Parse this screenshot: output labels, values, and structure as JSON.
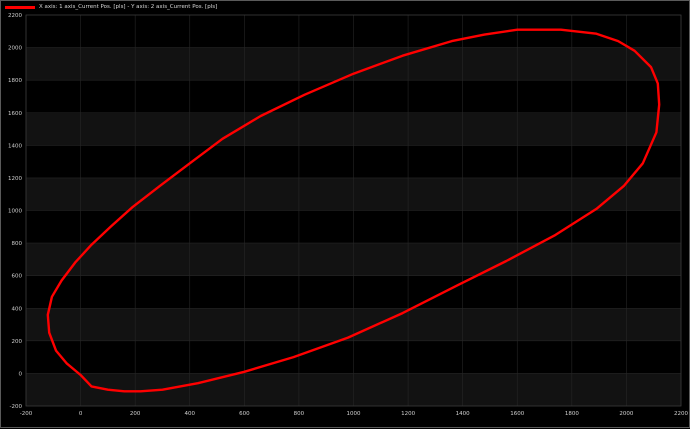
{
  "chart_data": {
    "type": "line",
    "title": "",
    "xlabel": "",
    "ylabel": "",
    "xlim": [
      -200,
      2200
    ],
    "ylim": [
      -200,
      2200
    ],
    "xticks": [
      -200,
      0,
      200,
      400,
      600,
      800,
      1000,
      1200,
      1400,
      1600,
      1800,
      2000,
      2200
    ],
    "yticks": [
      -200,
      0,
      200,
      400,
      600,
      800,
      1000,
      1200,
      1400,
      1600,
      1800,
      2000,
      2200
    ],
    "grid": true,
    "legend_position": "top-left",
    "series": [
      {
        "name": "X axis: 1 axis_Current Pos. [pls] - Y axis: 2 axis_Current Pos. [pls]",
        "color": "#ff0000",
        "x": [
          1600,
          1760,
          1890,
          1970,
          2030,
          2090,
          2115,
          2120,
          2110,
          2060,
          1990,
          1890,
          1740,
          1560,
          1380,
          1180,
          980,
          780,
          600,
          430,
          300,
          220,
          160,
          100,
          40,
          0,
          -50,
          -90,
          -115,
          -120,
          -105,
          -70,
          -20,
          40,
          110,
          190,
          290,
          400,
          520,
          660,
          820,
          1000,
          1180,
          1360,
          1480,
          1600
        ],
        "y": [
          2110,
          2110,
          2085,
          2040,
          1980,
          1880,
          1780,
          1650,
          1480,
          1290,
          1150,
          1010,
          850,
          690,
          540,
          370,
          220,
          100,
          10,
          -60,
          -100,
          -110,
          -110,
          -100,
          -80,
          -10,
          60,
          140,
          250,
          360,
          470,
          570,
          680,
          790,
          900,
          1020,
          1150,
          1290,
          1440,
          1580,
          1710,
          1840,
          1950,
          2040,
          2080,
          2110
        ]
      }
    ]
  }
}
